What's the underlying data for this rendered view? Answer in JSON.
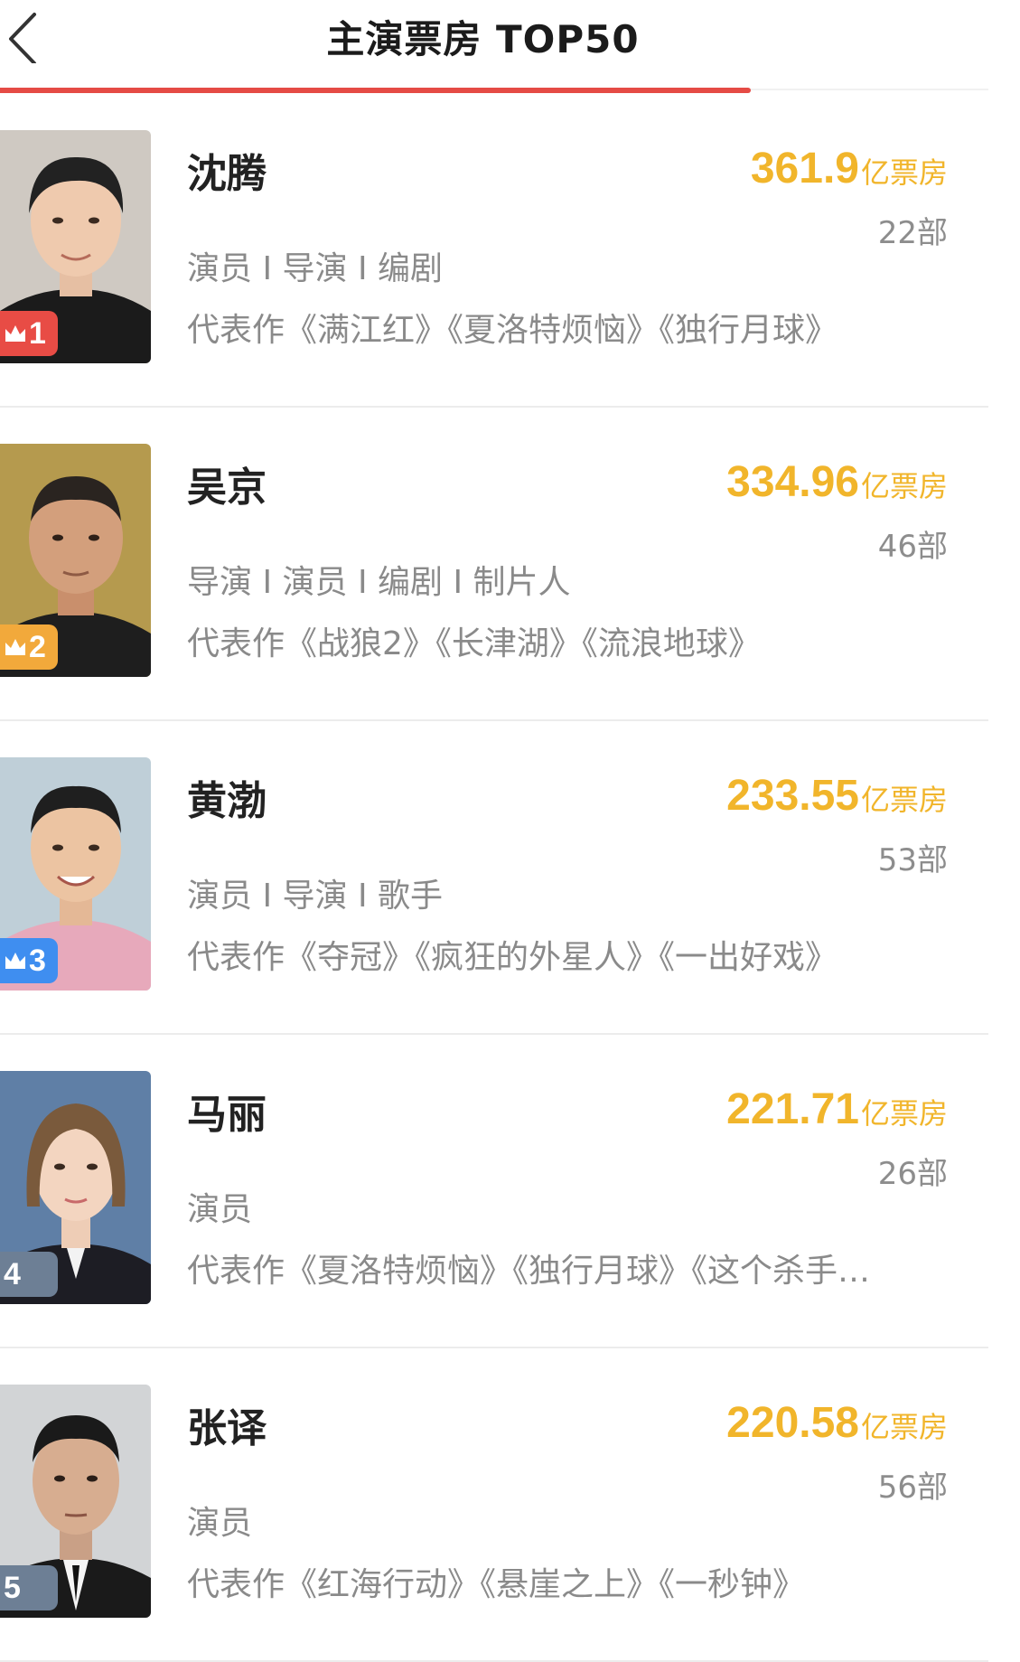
{
  "nav": {
    "title": "主演票房 TOP50",
    "progress": 0.76
  },
  "colors": {
    "accent_red": "#e54b45",
    "box_office_gold": "#f1b52b",
    "rank1": "#e84c45",
    "rank2": "#f2a93b",
    "rank3": "#3f8ef0",
    "rank_other": "#6d7f95"
  },
  "list": [
    {
      "rank": "1",
      "name": "沈腾",
      "box_value": "361.9",
      "box_unit": "亿票房",
      "films": "22部",
      "roles": "演员 I 导演 I 编剧",
      "works": "代表作《满江红》《夏洛特烦恼》《独行月球》",
      "badge_color": "#e84c45",
      "crown": true
    },
    {
      "rank": "2",
      "name": "吴京",
      "box_value": "334.96",
      "box_unit": "亿票房",
      "films": "46部",
      "roles": "导演 I 演员 I 编剧 I 制片人",
      "works": "代表作《战狼2》《长津湖》《流浪地球》",
      "badge_color": "#f2a93b",
      "crown": true
    },
    {
      "rank": "3",
      "name": "黄渤",
      "box_value": "233.55",
      "box_unit": "亿票房",
      "films": "53部",
      "roles": "演员 I 导演 I 歌手",
      "works": "代表作《夺冠》《疯狂的外星人》《一出好戏》",
      "badge_color": "#3f8ef0",
      "crown": true
    },
    {
      "rank": "4",
      "name": "马丽",
      "box_value": "221.71",
      "box_unit": "亿票房",
      "films": "26部",
      "roles": "演员",
      "works": "代表作《夏洛特烦恼》《独行月球》《这个杀手…",
      "badge_color": "#6d7f95",
      "crown": false
    },
    {
      "rank": "5",
      "name": "张译",
      "box_value": "220.58",
      "box_unit": "亿票房",
      "films": "56部",
      "roles": "演员",
      "works": "代表作《红海行动》《悬崖之上》《一秒钟》",
      "badge_color": "#6d7f95",
      "crown": false
    }
  ]
}
